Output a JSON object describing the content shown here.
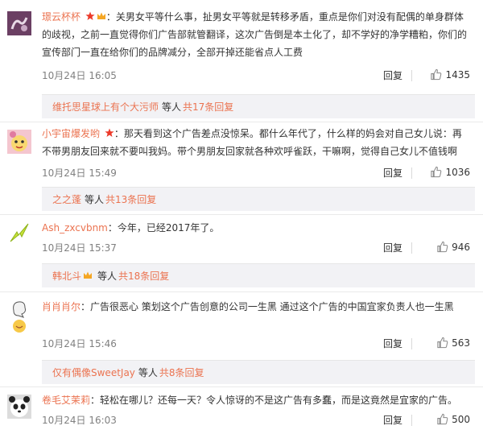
{
  "comments": [
    {
      "user": "璟云杯杯",
      "text": "关男女平等什么事，扯男女平等就是转移矛盾，重点是你们对没有配偶的单身群体的歧视，之前一直觉得你们广告部就管翻译，这次广告倒是本土化了，却不学好的净学糟粕，你们的宣传部门一直在给你们的品牌减分，全部开掉还能省点人工费",
      "time": "10月24日 16:05",
      "reply_label": "回复",
      "likes": "1435",
      "sub": {
        "name": "维托思星球上有个大污师",
        "deng": "等人",
        "more": "共17条回复"
      }
    },
    {
      "user": "小宇宙爆发哟",
      "text": "那天看到这个广告差点没惊呆。都什么年代了，什么样的妈会对自己女儿说：再不带男朋友回来就不要叫我妈。带个男朋友回家就各种欢呼雀跃，干嘛啊，觉得自己女儿不值钱啊",
      "time": "10月24日 15:49",
      "reply_label": "回复",
      "likes": "1036",
      "sub": {
        "name": "之之蓬",
        "deng": "等人",
        "more": "共13条回复"
      }
    },
    {
      "user": "Ash_zxcvbnm",
      "text": "今年，已经2017年了。",
      "time": "10月24日 15:37",
      "reply_label": "回复",
      "likes": "946",
      "sub": {
        "name": "韩北斗",
        "deng": "等人",
        "more": "共18条回复"
      }
    },
    {
      "user": "肖肖肖尔",
      "text": "广告很恶心 策划这个广告创意的公司一生黑 通过这个广告的中国宜家负责人也一生黑",
      "time": "10月24日 15:46",
      "reply_label": "回复",
      "likes": "563",
      "sub": {
        "name": "仅有偶像SweetJay",
        "deng": "等人",
        "more": "共8条回复"
      }
    },
    {
      "user": "卷毛艾茉莉",
      "text": "轻松在哪儿？还每一天？令人惊讶的不是这广告有多蠢，而是这竟然是宜家的广告。",
      "time": "10月24日 16:03",
      "reply_label": "回复",
      "likes": "500"
    }
  ],
  "colors": {
    "accent": "#eb7350",
    "meta": "#808080",
    "sub_bg": "#f2f2f5"
  },
  "icons": [
    "star-badge-icon",
    "vip-crown-icon",
    "thumbs-up-icon"
  ]
}
